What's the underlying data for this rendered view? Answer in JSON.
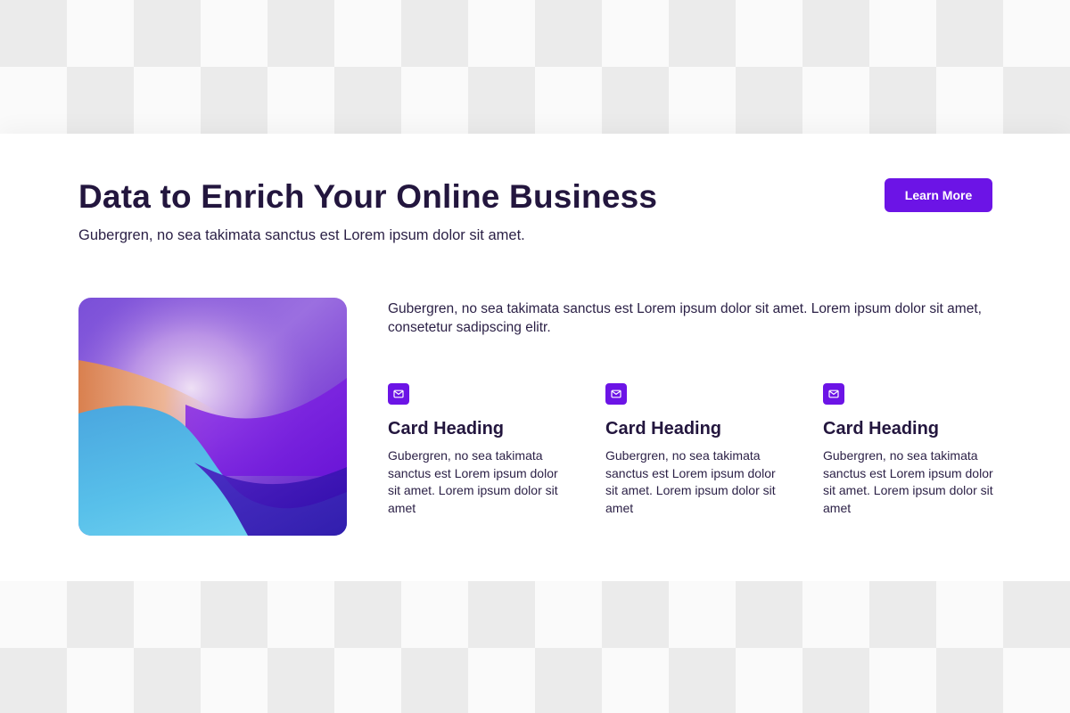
{
  "header": {
    "title": "Data to Enrich Your Online Business",
    "subtitle": "Gubergren, no sea takimata sanctus est Lorem ipsum dolor sit amet.",
    "cta_label": "Learn More"
  },
  "content": {
    "lead": "Gubergren, no sea takimata sanctus est Lorem ipsum dolor sit amet. Lorem ipsum dolor sit amet, consetetur sadipscing elitr.",
    "cards": [
      {
        "icon": "mail-icon",
        "heading": "Card Heading",
        "body": "Gubergren, no sea takimata sanctus est Lorem ipsum dolor sit amet. Lorem ipsum dolor sit amet"
      },
      {
        "icon": "mail-icon",
        "heading": "Card Heading",
        "body": "Gubergren, no sea takimata sanctus est Lorem ipsum dolor sit amet. Lorem ipsum dolor sit amet"
      },
      {
        "icon": "mail-icon",
        "heading": "Card Heading",
        "body": "Gubergren, no sea takimata sanctus est Lorem ipsum dolor sit amet. Lorem ipsum dolor sit amet"
      }
    ]
  },
  "colors": {
    "accent": "#6c14e6",
    "heading": "#23163e",
    "text": "#2a1f45",
    "panel": "#ffffff"
  }
}
